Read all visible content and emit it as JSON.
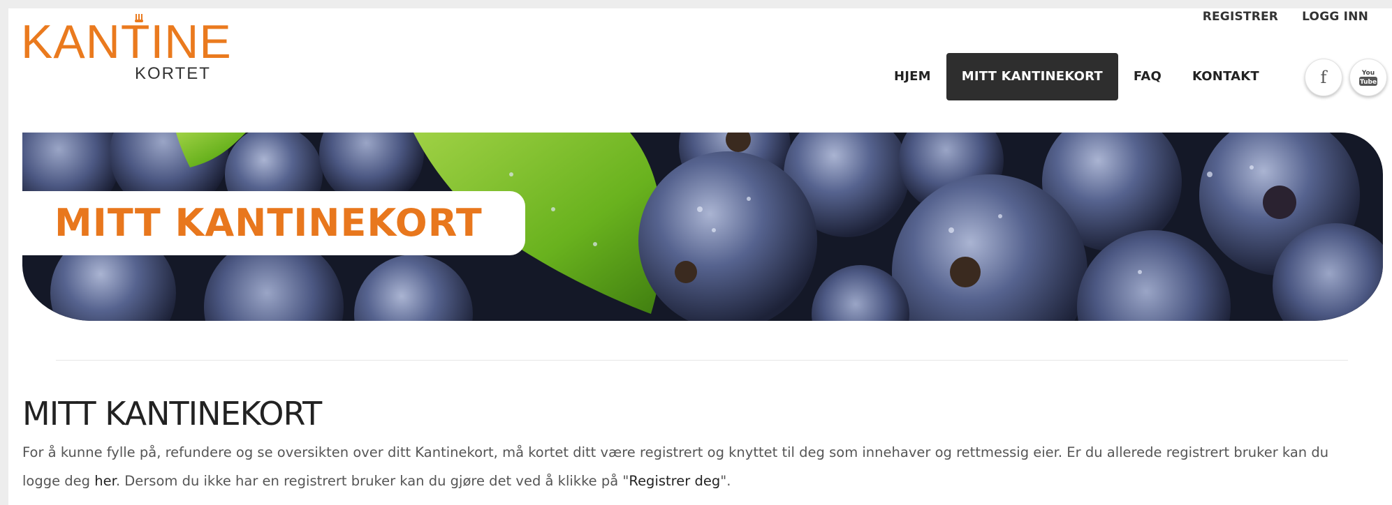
{
  "brand": {
    "name_main": "KANTINE",
    "name_sub": "KORTET",
    "accent_color": "#ea7a1e"
  },
  "top_links": {
    "register": "REGISTRER",
    "login": "LOGG INN"
  },
  "nav": {
    "items": [
      {
        "label": "HJEM",
        "active": false
      },
      {
        "label": "MITT KANTINEKORT",
        "active": true
      },
      {
        "label": "FAQ",
        "active": false
      },
      {
        "label": "KONTAKT",
        "active": false
      }
    ]
  },
  "social": {
    "facebook_icon": "facebook-icon",
    "facebook_glyph": "f",
    "youtube_icon": "youtube-icon",
    "youtube_top": "You",
    "youtube_bottom": "Tube"
  },
  "banner": {
    "label": "MITT KANTINEKORT",
    "image": "blueberries-banner-image"
  },
  "content": {
    "title": "MITT KANTINEKORT",
    "paragraph_part1": "For å kunne fylle på, refundere og se oversikten over ditt Kantinekort, må kortet ditt være registrert og knyttet til deg som innehaver og rettmessig eier. Er du allerede registrert bruker kan du logge deg ",
    "link_here": "her",
    "paragraph_part2": ". Dersom du ikke har en registrert bruker kan du gjøre det ved å klikke på \"",
    "link_register": "Registrer deg",
    "paragraph_part3": "\"."
  }
}
